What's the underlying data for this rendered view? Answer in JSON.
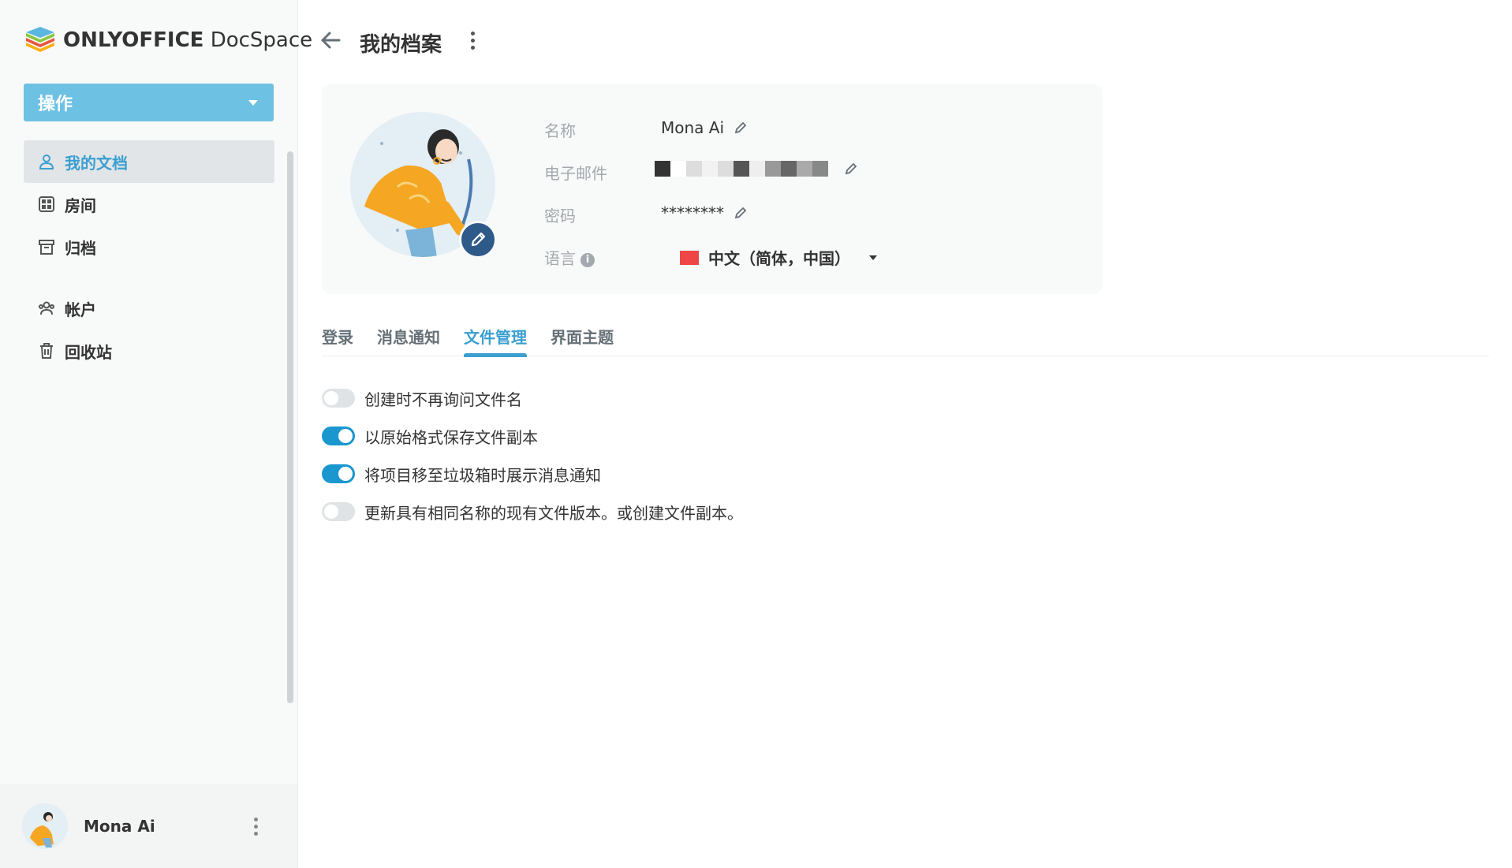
{
  "app": {
    "logo_brand": "ONLYOFFICE",
    "logo_product": "DocSpace"
  },
  "sidebar": {
    "actions_label": "操作",
    "items": [
      {
        "label": "我的文档",
        "icon": "user-icon",
        "active": true
      },
      {
        "label": "房间",
        "icon": "rooms-icon",
        "active": false
      },
      {
        "label": "归档",
        "icon": "archive-icon",
        "active": false
      },
      {
        "label": "帐户",
        "icon": "accounts-icon",
        "active": false
      },
      {
        "label": "回收站",
        "icon": "trash-icon",
        "active": false
      }
    ],
    "user_name": "Mona Ai"
  },
  "header": {
    "title": "我的档案"
  },
  "profile": {
    "name_label": "名称",
    "name_value": "Mona Ai",
    "email_label": "电子邮件",
    "password_label": "密码",
    "password_value": "********",
    "language_label": "语言",
    "language_value": "中文（简体，中国）"
  },
  "tabs": [
    {
      "label": "登录",
      "active": false
    },
    {
      "label": "消息通知",
      "active": false
    },
    {
      "label": "文件管理",
      "active": true
    },
    {
      "label": "界面主题",
      "active": false
    }
  ],
  "file_management": [
    {
      "label": "创建时不再询问文件名",
      "enabled": false
    },
    {
      "label": "以原始格式保存文件副本",
      "enabled": true
    },
    {
      "label": "将项目移至垃圾箱时展示消息通知",
      "enabled": true
    },
    {
      "label": "更新具有相同名称的现有文件版本。或创建文件副本。",
      "enabled": false
    }
  ],
  "colors": {
    "accent": "#3b9fd0",
    "action_button": "#6dc1e3",
    "toggle_on": "#1a97cf",
    "toggle_off": "#e0e3e6"
  }
}
